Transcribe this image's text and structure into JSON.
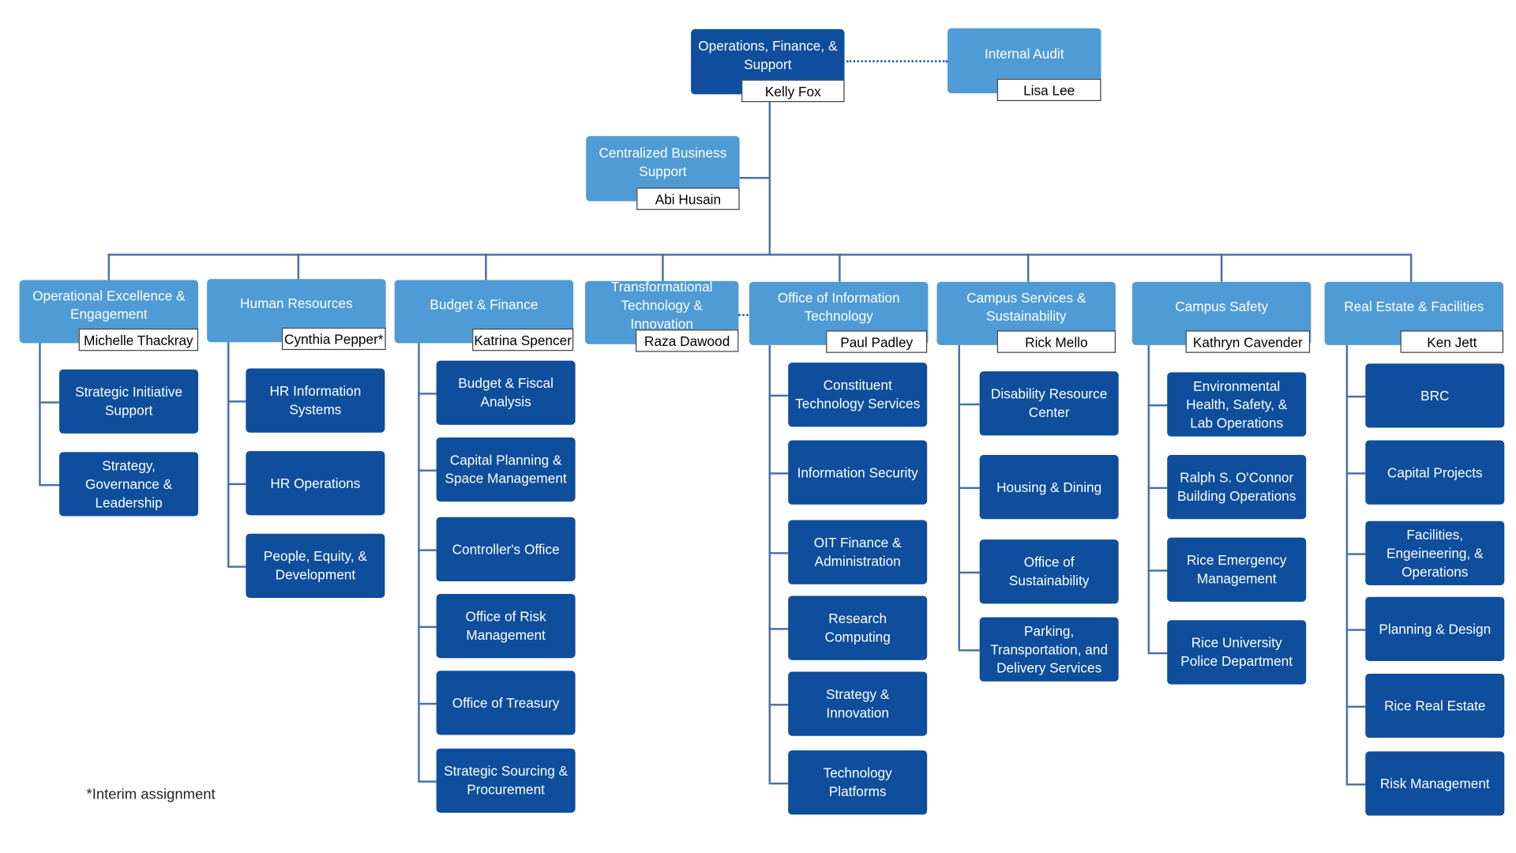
{
  "top": {
    "title": "Operations, Finance, & Support",
    "leader": "Kelly Fox"
  },
  "audit": {
    "title": "Internal Audit",
    "leader": "Lisa Lee"
  },
  "cbs": {
    "title": "Centralized Business Support",
    "leader": "Abi Husain"
  },
  "departments": [
    {
      "title": "Operational Excellence & Engagement",
      "leader": "Michelle Thackray",
      "units": [
        "Strategic Initiative Support",
        "Strategy, Governance & Leadership"
      ]
    },
    {
      "title": "Human Resources",
      "leader": "Cynthia Pepper*",
      "units": [
        "HR Information Systems",
        "HR Operations",
        "People, Equity, & Development"
      ]
    },
    {
      "title": "Budget & Finance",
      "leader": "Katrina Spencer",
      "units": [
        "Budget & Fiscal Analysis",
        "Capital Planning & Space Management",
        "Controller's Office",
        "Office of Risk Management",
        "Office of Treasury",
        "Strategic Sourcing & Procurement"
      ]
    },
    {
      "title": "Transformational Technology & Innovation",
      "leader": "Raza Dawood",
      "units": []
    },
    {
      "title": "Office of Information Technology",
      "leader": "Paul Padley",
      "units": [
        "Constituent Technology Services",
        "Information Security",
        "OIT Finance & Administration",
        "Research Computing",
        "Strategy & Innovation",
        "Technology Platforms"
      ]
    },
    {
      "title": "Campus Services & Sustainability",
      "leader": "Rick Mello",
      "units": [
        "Disability Resource Center",
        "Housing & Dining",
        "Office of Sustainability",
        "Parking, Transportation, and Delivery Services"
      ]
    },
    {
      "title": "Campus Safety",
      "leader": "Kathryn Cavender",
      "units": [
        "Environmental Health, Safety, & Lab Operations",
        "Ralph S. O'Connor Building Operations",
        "Rice Emergency Management",
        "Rice University Police Department"
      ]
    },
    {
      "title": "Real Estate & Facilities",
      "leader": "Ken Jett",
      "units": [
        "BRC",
        "Capital Projects",
        "Facilities, Engeineering, & Operations",
        "Planning & Design",
        "Rice Real Estate",
        "Risk Management"
      ]
    }
  ],
  "footnote": "*Interim assignment",
  "colors": {
    "leadership_box": "#0e4e9c",
    "department_box": "#4f9bd5",
    "unit_box": "#0e4e9c",
    "connector": "#4a6fa5"
  }
}
